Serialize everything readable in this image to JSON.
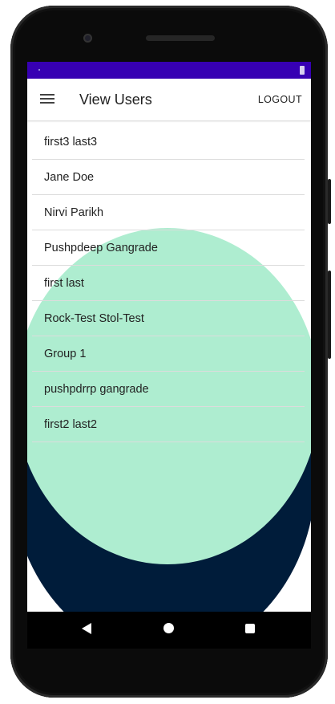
{
  "colors": {
    "status_bar": "#3700b3",
    "green_blob": "#aeedd0",
    "dark_blob": "#001c3a",
    "app_bar": "#ffffff"
  },
  "app_bar": {
    "menu_icon": "hamburger-menu-icon",
    "title": "View Users",
    "logout_label": "LOGOUT"
  },
  "users": [
    {
      "name": "first3 last3"
    },
    {
      "name": "Jane Doe"
    },
    {
      "name": "Nirvi Parikh"
    },
    {
      "name": "Pushpdeep Gangrade"
    },
    {
      "name": "first last"
    },
    {
      "name": "Rock-Test Stol-Test"
    },
    {
      "name": "Group 1"
    },
    {
      "name": "pushpdrrp gangrade"
    },
    {
      "name": "first2 last2"
    }
  ],
  "nav_bar": {
    "back_icon": "back-triangle-icon",
    "home_icon": "home-circle-icon",
    "recents_icon": "recents-square-icon"
  }
}
